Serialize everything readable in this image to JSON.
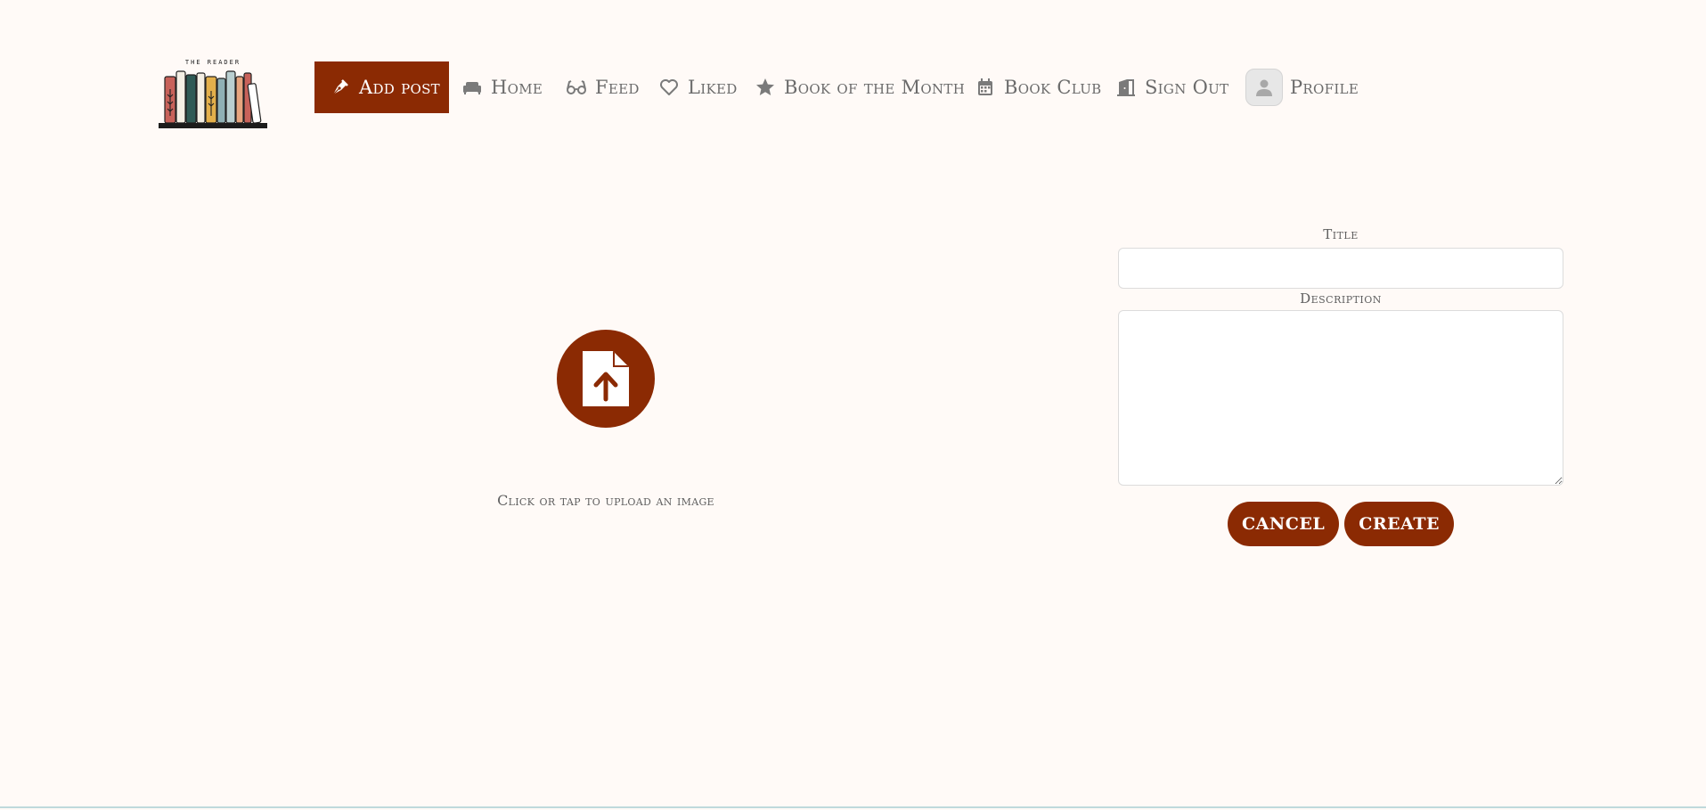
{
  "brand": {
    "logo_text": "THE READER",
    "colors": {
      "primary": "#8b2a03",
      "background": "#fffaf7",
      "text": "#6b6b6b"
    }
  },
  "nav": {
    "add_post": {
      "label": "Add post",
      "icon": "pen-nib-icon"
    },
    "home": {
      "label": "Home",
      "icon": "couch-icon"
    },
    "feed": {
      "label": "Feed",
      "icon": "glasses-icon"
    },
    "liked": {
      "label": "Liked",
      "icon": "heart-icon"
    },
    "book_of_the_month": {
      "label": "Book of the Month",
      "icon": "star-icon"
    },
    "book_club": {
      "label": "Book Club",
      "icon": "calendar-icon"
    },
    "sign_out": {
      "label": "Sign Out",
      "icon": "door-open-icon"
    },
    "profile": {
      "label": "Profile",
      "icon": "avatar-icon"
    }
  },
  "upload": {
    "icon": "file-upload-icon",
    "text": "Click or tap to upload an image"
  },
  "form": {
    "title_label": "Title",
    "title_value": "",
    "description_label": "Description",
    "description_value": "",
    "cancel_label": "CANCEL",
    "create_label": "CREATE"
  }
}
